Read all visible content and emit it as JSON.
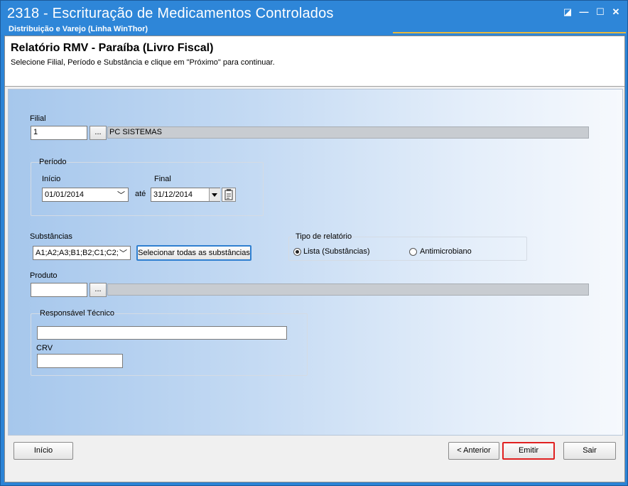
{
  "window": {
    "title": "2318 - Escrituração de Medicamentos Controlados",
    "subtitle": "Distribuição e Varejo (Linha WinThor)",
    "controls": [
      "◪",
      "—",
      "☐",
      "✕"
    ]
  },
  "header": {
    "title": "Relatório RMV - Paraíba (Livro Fiscal)",
    "description": "Selecione Filial, Período e Substância e clique em \"Próximo\" para continuar."
  },
  "filial": {
    "label": "Filial",
    "code": "1",
    "lookup_label": "...",
    "name": "PC SISTEMAS"
  },
  "periodo": {
    "label": "Período",
    "inicio_label": "Início",
    "inicio_value": "01/01/2014",
    "ate_label": "até",
    "final_label": "Final",
    "final_value": "31/12/2014"
  },
  "substancias": {
    "label": "Substâncias",
    "value": "A1;A2;A3;B1;B2;C1;C2;",
    "select_all_label": "Selecionar todas as substâncias"
  },
  "tipo_relatorio": {
    "label": "Tipo de relatório",
    "options": [
      {
        "label": "Lista (Substâncias)",
        "selected": true
      },
      {
        "label": "Antimicrobiano",
        "selected": false
      }
    ]
  },
  "produto": {
    "label": "Produto",
    "code": "",
    "lookup_label": "...",
    "name": ""
  },
  "responsavel": {
    "label": "Responsável Técnico",
    "value": "",
    "crv_label": "CRV",
    "crv_value": ""
  },
  "footer": {
    "inicio_label": "Início",
    "anterior_label": "< Anterior",
    "emitir_label": "Emitir",
    "sair_label": "Sair"
  },
  "colors": {
    "titlebar": "#2e86d8",
    "accent": "#e8b73c",
    "highlight": "#e02020"
  }
}
